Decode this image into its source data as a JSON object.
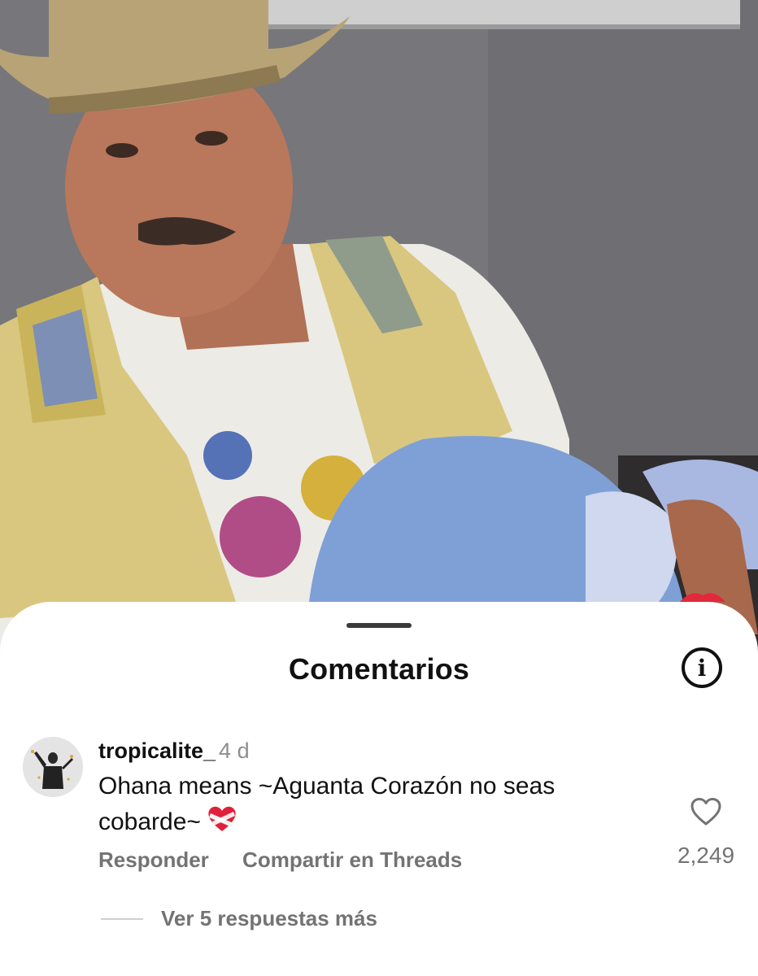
{
  "sheet": {
    "title": "Comentarios"
  },
  "comment": {
    "username": "tropicalite_",
    "time": "4 d",
    "text": "Ohana means ~Aguanta Corazón no seas cobarde~",
    "emoji": "❤️‍🩹",
    "likes": "2,249",
    "reply_label": "Responder",
    "share_label": "Compartir en Threads",
    "more_replies": "Ver 5 respuestas más"
  },
  "icons": {
    "info": "info-icon",
    "like": "heart-outline-icon",
    "emoji": "mending-heart-emoji"
  }
}
